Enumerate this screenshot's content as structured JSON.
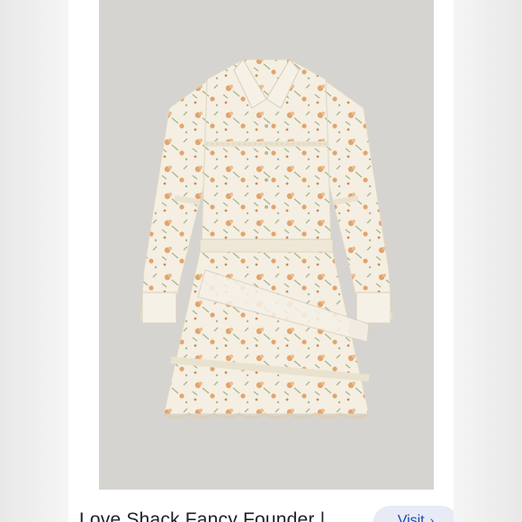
{
  "result": {
    "product_title": "Love Shack Fancy Founder |",
    "visit_label": "Visit",
    "visit_icon": "chevron-right-icon",
    "image_subject": "dress-product-photo"
  },
  "colors": {
    "photo_background": "#d6d4d1",
    "dress_base": "#f4efe2",
    "floral_orange": "#e2a46e",
    "floral_green": "#a9b58c",
    "visit_bg": "#e8eaf6",
    "visit_text": "#1a4ba8"
  }
}
